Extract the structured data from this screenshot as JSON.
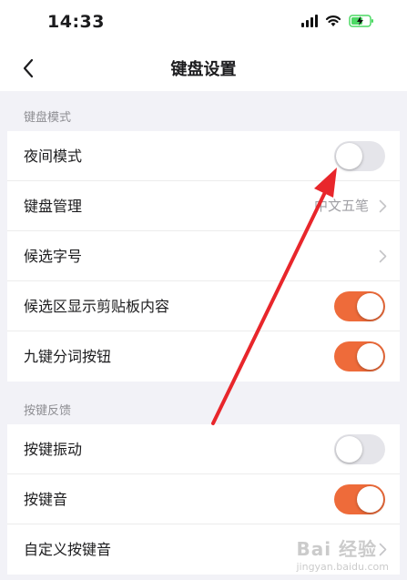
{
  "status_bar": {
    "time": "14:33"
  },
  "nav": {
    "title": "键盘设置"
  },
  "sections": [
    {
      "header": "键盘模式",
      "rows": [
        {
          "label": "夜间模式",
          "control": "toggle",
          "on": false
        },
        {
          "label": "键盘管理",
          "control": "link",
          "value": "中文五笔"
        },
        {
          "label": "候选字号",
          "control": "link",
          "value": ""
        },
        {
          "label": "候选区显示剪贴板内容",
          "control": "toggle",
          "on": true
        },
        {
          "label": "九键分词按钮",
          "control": "toggle",
          "on": true
        }
      ]
    },
    {
      "header": "按键反馈",
      "rows": [
        {
          "label": "按键振动",
          "control": "toggle",
          "on": false
        },
        {
          "label": "按键音",
          "control": "toggle",
          "on": true
        },
        {
          "label": "自定义按键音",
          "control": "link",
          "value": ""
        }
      ]
    }
  ],
  "colors": {
    "accent": "#ee6b3a",
    "toggle_off": "#e5e5ea",
    "arrow": "#e8262b"
  },
  "watermark": {
    "brand": "Bai 经验",
    "url": "jingyan.baidu.com"
  }
}
